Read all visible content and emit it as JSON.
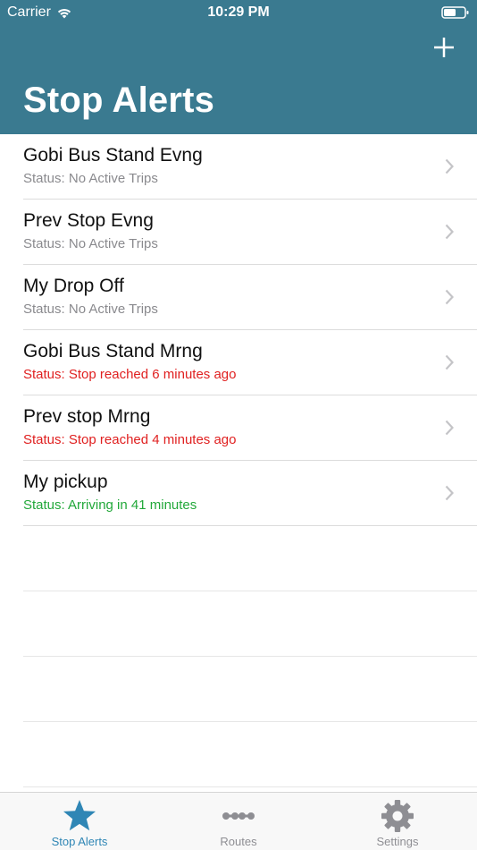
{
  "status_bar": {
    "carrier": "Carrier",
    "time": "10:29 PM"
  },
  "header": {
    "title": "Stop Alerts",
    "add_icon": "plus-icon",
    "background_color": "#3a7a90"
  },
  "alerts": [
    {
      "name": "Gobi Bus Stand Evng",
      "status": "Status: No Active Trips",
      "status_color": "#8a8a8e"
    },
    {
      "name": "Prev Stop Evng",
      "status": "Status: No Active Trips",
      "status_color": "#8a8a8e"
    },
    {
      "name": "My Drop Off",
      "status": "Status: No Active Trips",
      "status_color": "#8a8a8e"
    },
    {
      "name": "Gobi Bus Stand Mrng",
      "status": "Status: Stop reached 6 minutes ago",
      "status_color": "#e02020"
    },
    {
      "name": "Prev stop Mrng",
      "status": "Status: Stop reached 4 minutes ago",
      "status_color": "#e02020"
    },
    {
      "name": "My pickup",
      "status": "Status: Arriving in 41 minutes",
      "status_color": "#22a83a"
    }
  ],
  "tabbar": {
    "tabs": [
      {
        "label": "Stop Alerts",
        "icon": "star-icon",
        "active": true
      },
      {
        "label": "Routes",
        "icon": "route-icon",
        "active": false
      },
      {
        "label": "Settings",
        "icon": "gear-icon",
        "active": false
      }
    ],
    "active_color": "#2f86b5",
    "inactive_color": "#8e8e93"
  }
}
